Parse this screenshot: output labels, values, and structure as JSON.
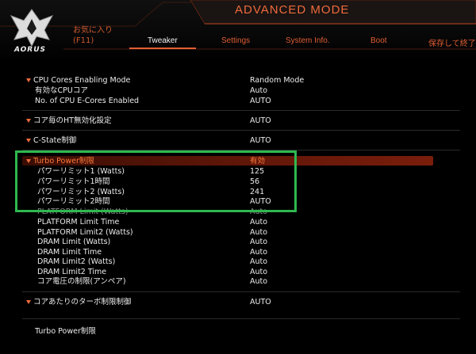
{
  "header": {
    "brand": "AORUS",
    "mode_title": "ADVANCED MODE",
    "favorites": {
      "line1": "お気に入り",
      "line2": "(F11)"
    },
    "tabs": [
      {
        "label": "Tweaker",
        "active": true
      },
      {
        "label": "Settings",
        "active": false
      },
      {
        "label": "System Info.",
        "active": false
      },
      {
        "label": "Boot",
        "active": false
      },
      {
        "label": "保存して終了",
        "active": false
      }
    ]
  },
  "colors": {
    "accent": "#ee6a3c",
    "highlight_box": "#2fb84f",
    "selected_bar": "#7a1d0b"
  },
  "settings": [
    {
      "label": "CPU Cores Enabling Mode",
      "value": "Random Mode",
      "expandable": true
    },
    {
      "label": "有効なCPUコア",
      "value": "Auto"
    },
    {
      "label": "No. of CPU E-Cores Enabled",
      "value": "AUTO"
    },
    {
      "label": "コア毎のHT無効化設定",
      "value": "AUTO",
      "expandable": true
    },
    {
      "label": "C-State制御",
      "value": "AUTO",
      "expandable": true
    },
    {
      "label": "Turbo Power制限",
      "value": "有効",
      "expandable": true,
      "selected": true
    },
    {
      "label": "パワーリミット1 (Watts)",
      "value": "125"
    },
    {
      "label": "パワーリミット1時間",
      "value": "56"
    },
    {
      "label": "パワーリミット2 (Watts)",
      "value": "241"
    },
    {
      "label": "パワーリミット2時間",
      "value": "AUTO"
    },
    {
      "label": "PLATFORM Limit (Watts)",
      "value": "Auto"
    },
    {
      "label": "PLATFORM Limit Time",
      "value": "Auto"
    },
    {
      "label": "PLATFORM Limit2 (Watts)",
      "value": "Auto"
    },
    {
      "label": "DRAM Limit (Watts)",
      "value": "Auto"
    },
    {
      "label": "DRAM Limit Time",
      "value": "Auto"
    },
    {
      "label": "DRAM Limit2 (Watts)",
      "value": "Auto"
    },
    {
      "label": "DRAM Limit2 Time",
      "value": "Auto"
    },
    {
      "label": "コア電圧の制限(アンペア)",
      "value": "Auto"
    },
    {
      "label": "コアあたりのターボ制限制御",
      "value": "AUTO",
      "expandable": true
    }
  ],
  "help_text": "Turbo Power制限"
}
